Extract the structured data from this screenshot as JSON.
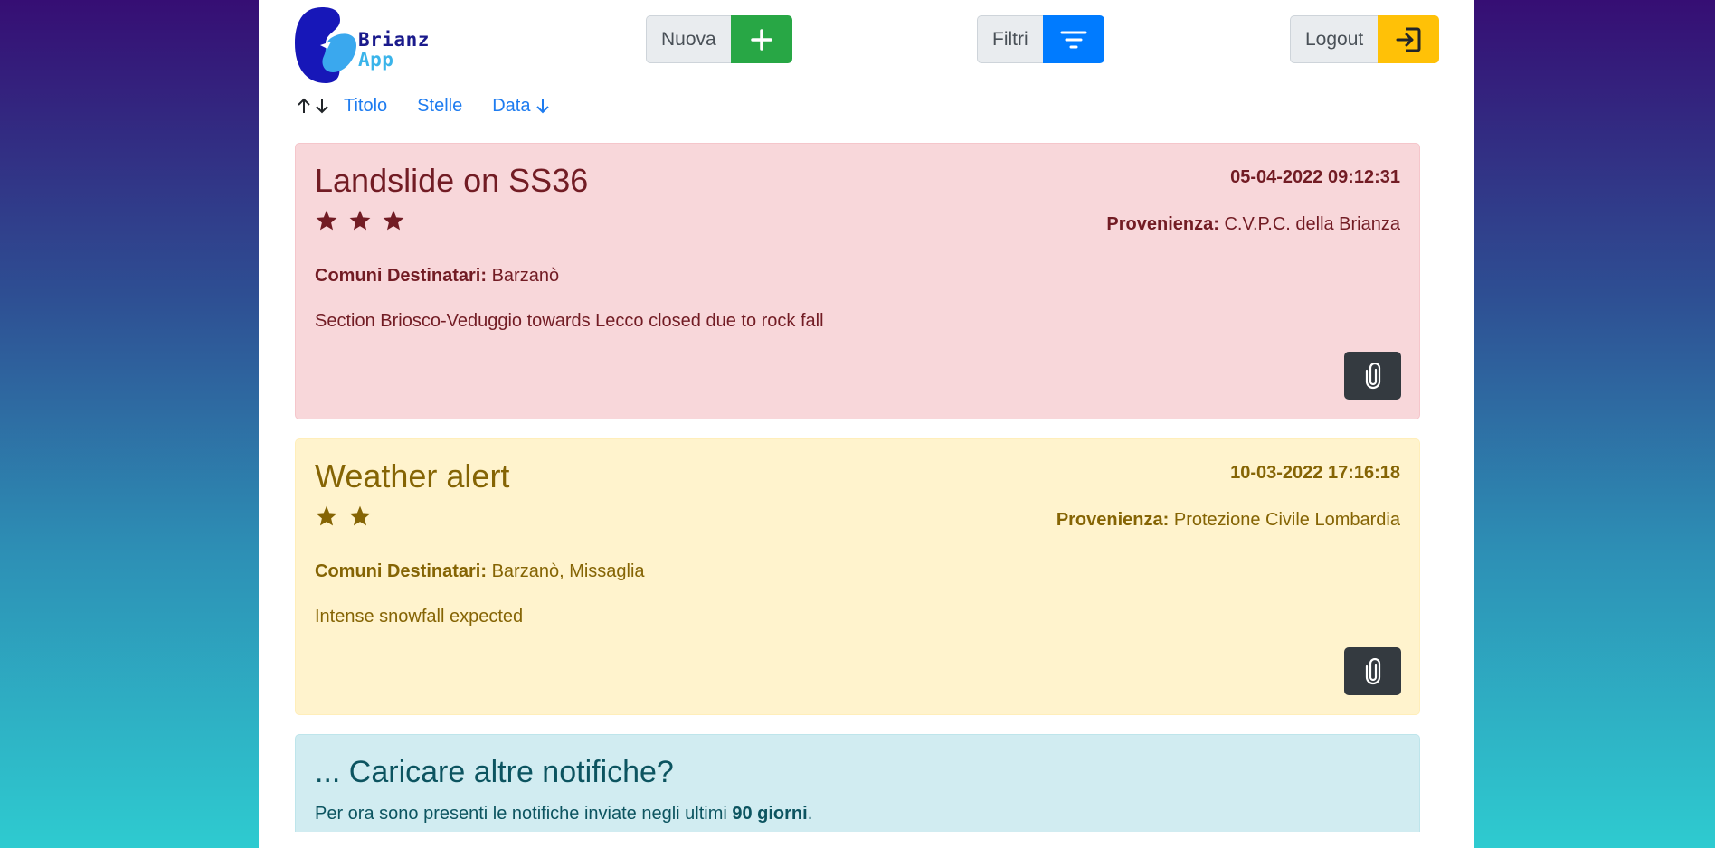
{
  "app": {
    "logo_line1": "Brianz",
    "logo_line2": "App"
  },
  "toolbar": {
    "new_label": "Nuova",
    "filter_label": "Filtri",
    "logout_label": "Logout",
    "colors": {
      "new": "#28a745",
      "filter": "#007bff",
      "logout": "#ffc107"
    }
  },
  "sort": {
    "title": "Titolo",
    "stars": "Stelle",
    "date": "Data"
  },
  "notifications": [
    {
      "title": "Landslide on SS36",
      "date": "05-04-2022 09:12:31",
      "stars": 3,
      "origin_label": "Provenienza:",
      "origin": "C.V.P.C. della Brianza",
      "comuni_label": "Comuni Destinatari:",
      "comuni": "Barzanò",
      "description": "Section Briosco-Veduggio towards Lecco closed due to rock fall",
      "style": "danger"
    },
    {
      "title": "Weather alert",
      "date": "10-03-2022 17:16:18",
      "stars": 2,
      "origin_label": "Provenienza:",
      "origin": "Protezione Civile Lombardia",
      "comuni_label": "Comuni Destinatari:",
      "comuni": "Barzanò, Missaglia",
      "description": "Intense snowfall expected",
      "style": "warning"
    }
  ],
  "more": {
    "title": "... Caricare altre notifiche?",
    "text_before": "Per ora sono presenti le notifiche inviate negli ultimi ",
    "days": "90 giorni",
    "text_after": "."
  }
}
